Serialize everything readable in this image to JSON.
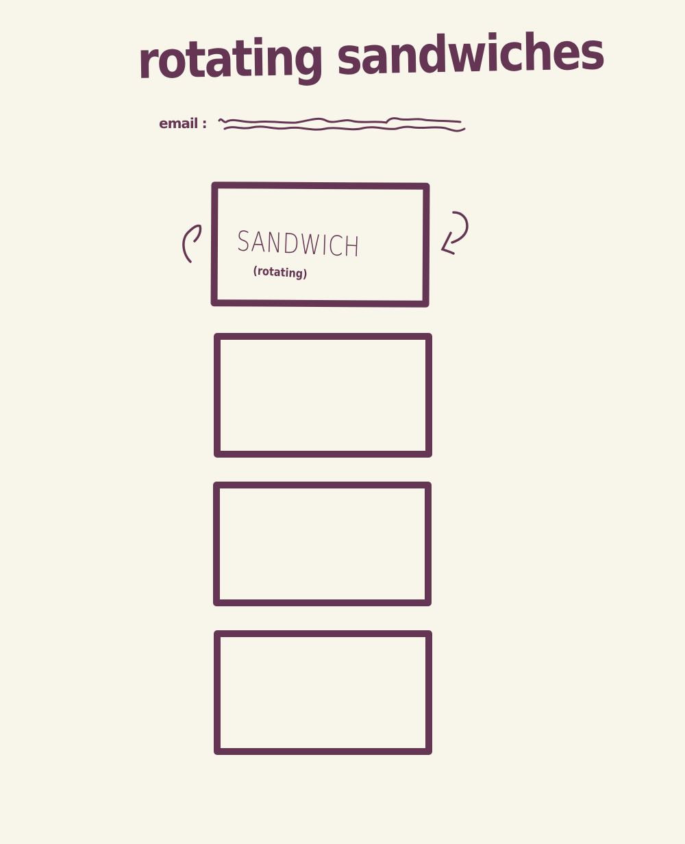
{
  "header": {
    "title": "rotating sandwiches"
  },
  "email": {
    "label": "email :"
  },
  "cards": [
    {
      "title": "SANDWICH",
      "subtitle": "(rotating)"
    }
  ],
  "icons": {
    "rotate_left": "rotate-left-icon",
    "rotate_right": "rotate-right-icon"
  },
  "colors": {
    "ink": "#653654",
    "background": "#f8f5ea"
  }
}
